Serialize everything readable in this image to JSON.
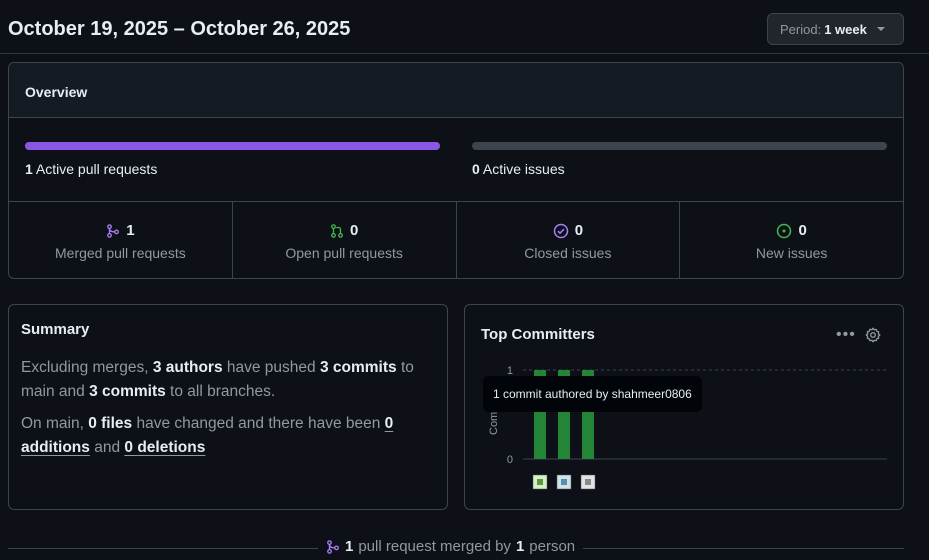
{
  "header": {
    "date_range": "October 19, 2025 – October 26, 2025",
    "period_label": "Period:",
    "period_value": "1 week"
  },
  "overview": {
    "title": "Overview",
    "active_prs": {
      "count": "1",
      "label": "Active pull requests",
      "fill": 1.0
    },
    "active_issues": {
      "count": "0",
      "label": "Active issues",
      "fill": 0.0
    },
    "stats": [
      {
        "count": "1",
        "label": "Merged pull requests",
        "icon": "merge-icon",
        "color": "#ab7df8"
      },
      {
        "count": "0",
        "label": "Open pull requests",
        "icon": "pull-request-icon",
        "color": "#3fb950"
      },
      {
        "count": "0",
        "label": "Closed issues",
        "icon": "issue-closed-icon",
        "color": "#ab7df8"
      },
      {
        "count": "0",
        "label": "New issues",
        "icon": "issue-opened-icon",
        "color": "#3fb950"
      }
    ]
  },
  "summary": {
    "title": "Summary",
    "p1": {
      "t1": "Excluding merges, ",
      "authors": "3 authors",
      "t2": " have pushed ",
      "commits1": "3 commits",
      "t3": " to main and ",
      "commits2": "3 commits",
      "t4": " to all branches."
    },
    "p2": {
      "t1": "On main, ",
      "files": "0 files",
      "t2": " have changed and there have been ",
      "additions_num": "0",
      "additions_word": "additions",
      "t3": " and ",
      "deletions_num": "0",
      "deletions_word": "deletions"
    }
  },
  "top_committers": {
    "title": "Top Committers",
    "more_icon": "kebab-horizontal-icon",
    "settings_icon": "gear-icon",
    "tooltip": "1 commit authored by shahmeer0806",
    "chart_data": {
      "type": "bar",
      "categories": [
        "",
        "",
        ""
      ],
      "values": [
        1,
        1,
        1
      ],
      "ylabel": "Com",
      "yticks": [
        "0",
        "1"
      ],
      "ylim": [
        0,
        1
      ],
      "bar_color": "#238636"
    }
  },
  "footer": {
    "count1": "1",
    "t1": "pull request merged by",
    "count2": "1",
    "t2": "person"
  }
}
